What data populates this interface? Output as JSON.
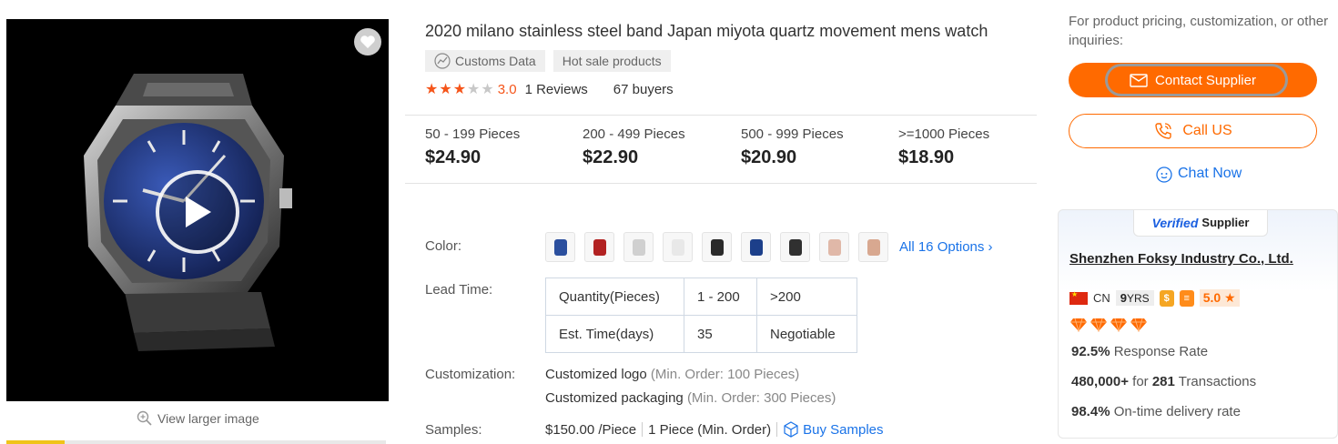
{
  "gallery": {
    "view_larger": "View larger image"
  },
  "product": {
    "title": "2020 milano stainless steel band Japan miyota quartz movement mens watch",
    "tags": [
      "Customs Data",
      "Hot sale products"
    ],
    "rating": {
      "score": "3.0",
      "stars_filled": 3,
      "stars_total": 5,
      "reviews": "1 Reviews",
      "buyers": "67 buyers"
    },
    "price_tiers": [
      {
        "range": "50 - 199 Pieces",
        "price": "$24.90"
      },
      {
        "range": "200 - 499 Pieces",
        "price": "$22.90"
      },
      {
        "range": "500 - 999 Pieces",
        "price": "$20.90"
      },
      {
        "range": ">=1000 Pieces",
        "price": "$18.90"
      }
    ],
    "color": {
      "label": "Color:",
      "swatches": [
        "#2b4f9e",
        "#b22222",
        "#d0d0d0",
        "#e8e8e8",
        "#2a2a2a",
        "#1c3f8a",
        "#303030",
        "#e0b8a8",
        "#d8a890"
      ],
      "all_options": "All 16 Options"
    },
    "lead_time": {
      "label": "Lead Time:",
      "rows": [
        [
          "Quantity(Pieces)",
          "1 - 200",
          ">200"
        ],
        [
          "Est. Time(days)",
          "35",
          "Negotiable"
        ]
      ]
    },
    "customization": {
      "label": "Customization:",
      "items": [
        {
          "name": "Customized logo",
          "min": "(Min. Order: 100 Pieces)"
        },
        {
          "name": "Customized packaging",
          "min": "(Min. Order: 300 Pieces)"
        }
      ]
    },
    "samples": {
      "label": "Samples:",
      "price": "$150.00 /Piece",
      "min_order": "1 Piece (Min. Order)",
      "buy_label": "Buy Samples"
    }
  },
  "sidebar": {
    "inquiry_text": "For product pricing, customization, or other inquiries:",
    "contact_button": "Contact Supplier",
    "call_button": "Call US",
    "chat_button": "Chat Now",
    "supplier": {
      "verified_prefix": "Verified",
      "verified_suffix": "Supplier",
      "company": "Shenzhen Foksy Industry Co., Ltd.",
      "country": "CN",
      "years": "9",
      "years_unit": "YRS",
      "score": "5.0",
      "diamonds": 4,
      "response_rate_value": "92.5%",
      "response_rate_label": "Response Rate",
      "transactions_value": "480,000+",
      "transactions_for": "for",
      "transactions_count": "281",
      "transactions_label": "Transactions",
      "ontime_value": "98.4%",
      "ontime_label": "On-time delivery rate"
    }
  },
  "colors": {
    "accent": "#ff6a00",
    "link": "#1a73e8",
    "star": "#f5551a"
  }
}
